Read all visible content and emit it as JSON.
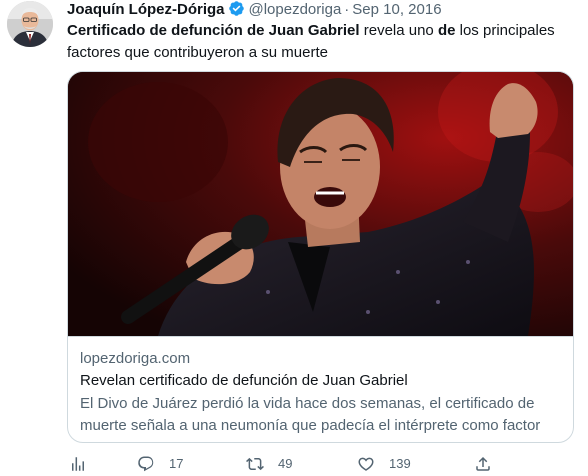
{
  "tweet": {
    "author": {
      "display_name": "Joaquín López-Dóriga",
      "handle": "@lopezdoriga",
      "verified_icon": "verified-badge-icon"
    },
    "separator": "·",
    "date": "Sep 10, 2016",
    "text": {
      "bold_1": "Certificado de defunción de Juan Gabriel",
      "plain_1": " revela uno ",
      "bold_2": "de",
      "plain_2": " los principales factores que contribuyeron a su muerte"
    },
    "card": {
      "domain": "lopezdoriga.com",
      "title": "Revelan certificado de defunción de Juan Gabriel",
      "description": "El Divo de Juárez perdió la vida hace dos semanas, el certificado de muerte señala a una neumonía que padecía el intérprete como factor"
    },
    "actions": {
      "analytics_icon": "analytics-icon",
      "reply_icon": "reply-icon",
      "reply_count": "17",
      "retweet_icon": "retweet-icon",
      "retweet_count": "49",
      "like_icon": "heart-icon",
      "like_count": "139",
      "share_icon": "share-icon"
    }
  },
  "colors": {
    "text_primary": "#0f1419",
    "text_secondary": "#536471",
    "verified_blue": "#1d9bf0",
    "border": "#cfd9de"
  }
}
